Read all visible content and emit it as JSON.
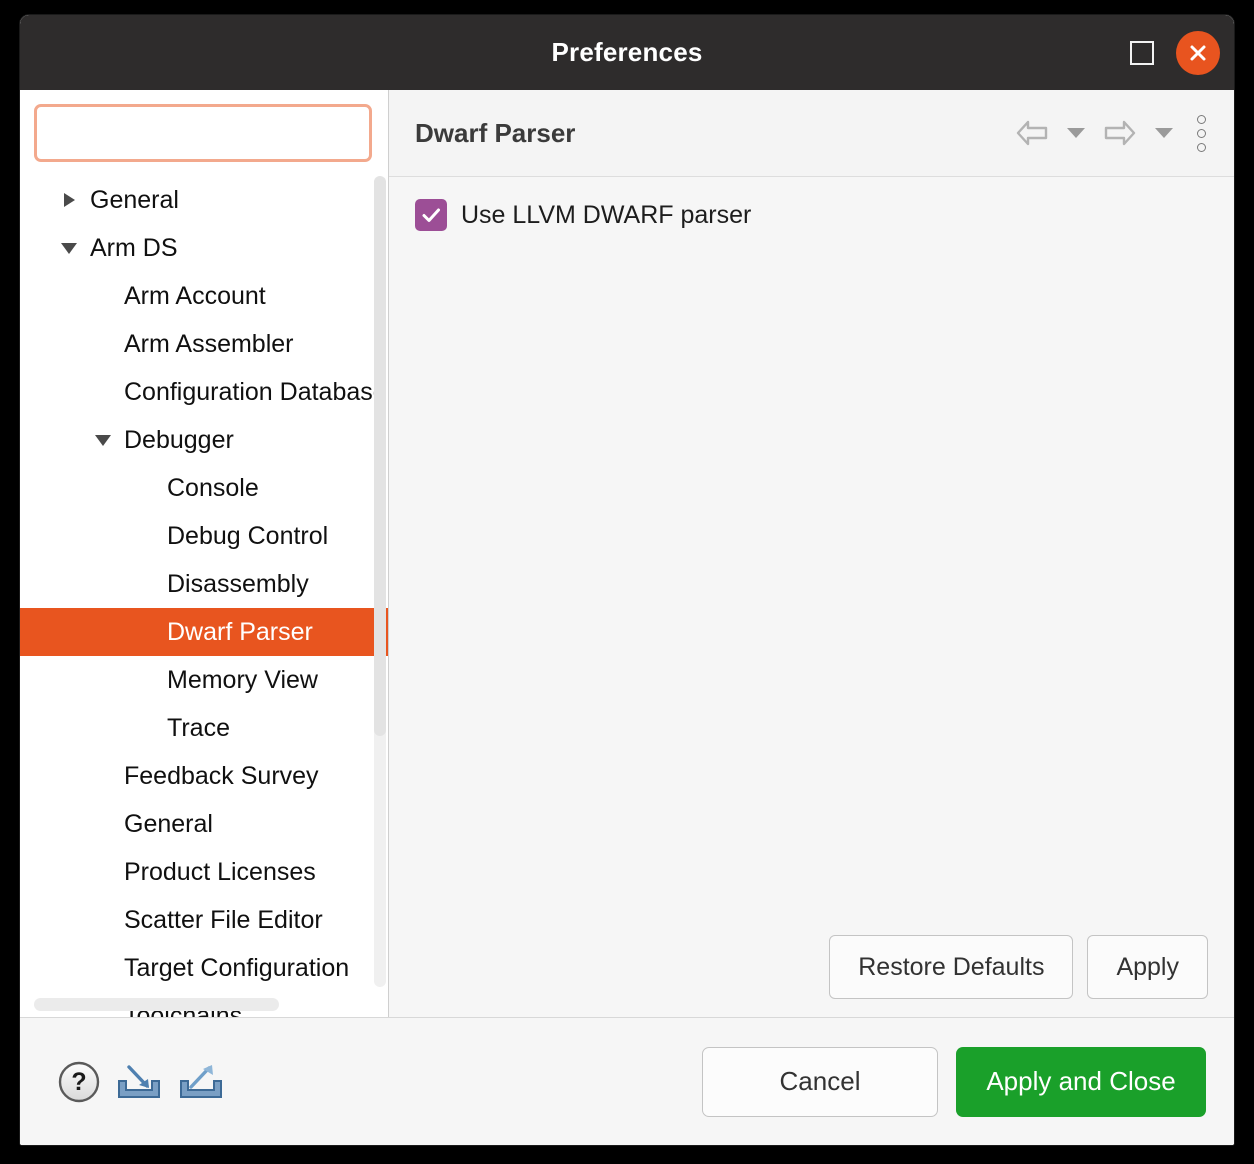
{
  "window": {
    "title": "Preferences",
    "maximize_icon": "maximize-icon",
    "close_icon": "close-icon",
    "close_button_color": "#e8541f",
    "titlebar_color": "#2e2c2c"
  },
  "sidebar": {
    "search": {
      "value": "",
      "placeholder": "",
      "focus_border_color": "#f3a98d"
    },
    "selection_color": "#e8551f",
    "tree": [
      {
        "label": "General",
        "level": 0,
        "twisty": "collapsed",
        "selected": false
      },
      {
        "label": "Arm DS",
        "level": 0,
        "twisty": "expanded",
        "selected": false
      },
      {
        "label": "Arm Account",
        "level": 1,
        "twisty": "none",
        "selected": false
      },
      {
        "label": "Arm Assembler",
        "level": 1,
        "twisty": "none",
        "selected": false
      },
      {
        "label": "Configuration Database",
        "level": 1,
        "twisty": "none",
        "selected": false
      },
      {
        "label": "Debugger",
        "level": 1,
        "twisty": "expanded",
        "selected": false
      },
      {
        "label": "Console",
        "level": 2,
        "twisty": "none",
        "selected": false
      },
      {
        "label": "Debug Control",
        "level": 2,
        "twisty": "none",
        "selected": false
      },
      {
        "label": "Disassembly",
        "level": 2,
        "twisty": "none",
        "selected": false
      },
      {
        "label": "Dwarf Parser",
        "level": 2,
        "twisty": "none",
        "selected": true
      },
      {
        "label": "Memory View",
        "level": 2,
        "twisty": "none",
        "selected": false
      },
      {
        "label": "Trace",
        "level": 2,
        "twisty": "none",
        "selected": false
      },
      {
        "label": "Feedback Survey",
        "level": 1,
        "twisty": "none",
        "selected": false
      },
      {
        "label": "General",
        "level": 1,
        "twisty": "none",
        "selected": false
      },
      {
        "label": "Product Licenses",
        "level": 1,
        "twisty": "none",
        "selected": false
      },
      {
        "label": "Scatter File Editor",
        "level": 1,
        "twisty": "none",
        "selected": false
      },
      {
        "label": "Target Configuration",
        "level": 1,
        "twisty": "none",
        "selected": false
      },
      {
        "label": "Toolchains",
        "level": 1,
        "twisty": "none",
        "selected": false
      }
    ]
  },
  "main": {
    "title": "Dwarf Parser",
    "toolbar": {
      "back_icon": "back-arrow-icon",
      "back_menu_icon": "chevron-down-icon",
      "forward_icon": "forward-arrow-icon",
      "forward_menu_icon": "chevron-down-icon",
      "menu_icon": "kebab-menu-icon"
    },
    "options": [
      {
        "label": "Use LLVM DWARF parser",
        "checked": true,
        "check_color": "#9c4e96"
      }
    ],
    "buttons": {
      "restore_defaults": "Restore Defaults",
      "apply": "Apply"
    }
  },
  "footer": {
    "help_icon": "help-icon",
    "import_icon": "import-icon",
    "export_icon": "export-icon",
    "cancel": "Cancel",
    "apply_and_close": "Apply and Close",
    "apply_and_close_color": "#1aa02a"
  }
}
